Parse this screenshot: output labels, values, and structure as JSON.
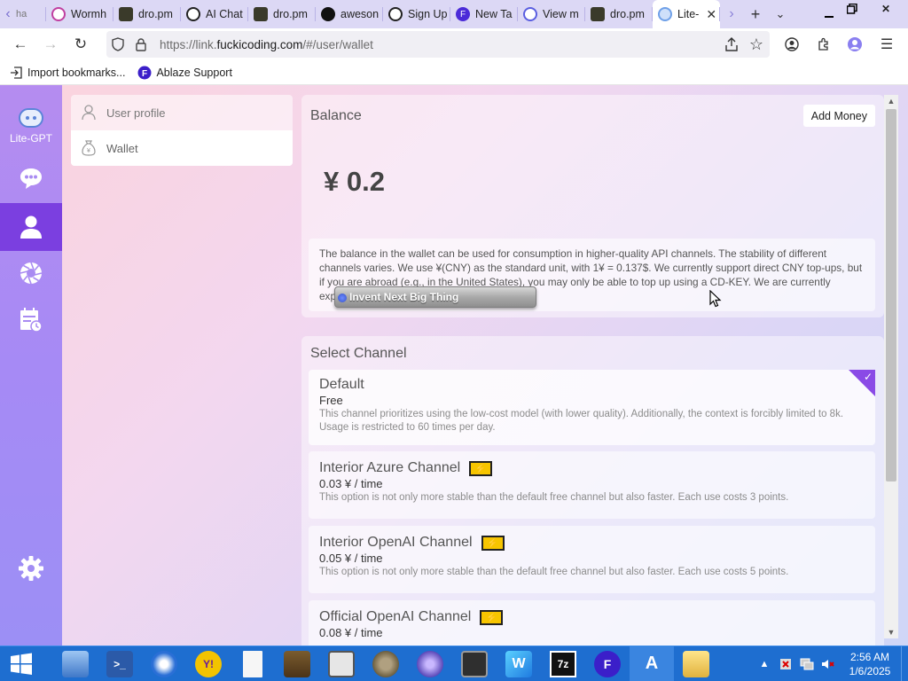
{
  "browser": {
    "tabs": [
      {
        "label": "Wormh",
        "icon": "wormhole-icon",
        "color": "#c03fa0"
      },
      {
        "label": "dro.pm",
        "icon": "dropm-icon",
        "color": "#3a3a2a"
      },
      {
        "label": "AI Chat",
        "icon": "ai-chat-icon",
        "color": "#222222"
      },
      {
        "label": "dro.pm",
        "icon": "dropm-icon",
        "color": "#3a3a2a"
      },
      {
        "label": "aweson",
        "icon": "github-icon",
        "color": "#111111"
      },
      {
        "label": "Sign Up",
        "icon": "openai-icon",
        "color": "#222222"
      },
      {
        "label": "New Ta",
        "icon": "ablaze-icon",
        "color": "#4b2bd8"
      },
      {
        "label": "View m",
        "icon": "view-icon",
        "color": "#5a5ee0"
      },
      {
        "label": "dro.pm",
        "icon": "dropm-icon",
        "color": "#3a3a2a"
      },
      {
        "label": "Lite-",
        "icon": "lite-gpt-icon",
        "color": "#6fa0e8"
      }
    ],
    "url": {
      "prefix": "https://link.",
      "domain": "fuckicoding.com",
      "path": "/#/user/wallet"
    },
    "bookmarks": [
      {
        "label": "Import bookmarks...",
        "icon": "import-icon"
      },
      {
        "label": "Ablaze Support",
        "icon": "ablaze-icon"
      }
    ]
  },
  "sidebar": {
    "app_label": "Lite-GPT",
    "items": [
      {
        "name": "chat",
        "icon": "chat-icon"
      },
      {
        "name": "user",
        "icon": "user-icon",
        "active": true
      },
      {
        "name": "aperture",
        "icon": "aperture-icon"
      },
      {
        "name": "history",
        "icon": "history-icon"
      },
      {
        "name": "settings",
        "icon": "gear-icon"
      }
    ]
  },
  "menu": {
    "items": [
      {
        "label": "User profile",
        "icon": "user-outline-icon"
      },
      {
        "label": "Wallet",
        "icon": "money-bag-icon",
        "active": true
      }
    ]
  },
  "balance": {
    "title": "Balance",
    "add_money_label": "Add Money",
    "amount": "¥ 0.2",
    "description": "The balance in the wallet can be used for consumption in higher-quality API channels. The stability of different channels varies. We use ¥(CNY) as the standard unit, with 1¥ = 0.137$. We currently support direct CNY top-ups, but if you are abroad (e.g., in the United States), you may only be able to top up using a CD-KEY. We are currently exploring payments abroad."
  },
  "tooltip": {
    "text": "Invent Next Big Thing"
  },
  "channels": {
    "title": "Select Channel",
    "items": [
      {
        "name": "Default",
        "price": "Free",
        "description": "This channel prioritizes using the low-cost model (with lower quality). Additionally, the context is forcibly limited to 8k. Usage is restricted to 60 times per day.",
        "selected": true
      },
      {
        "name": "Interior Azure Channel",
        "price": "0.03 ¥ / time",
        "description": "This option is not only more stable than the default free channel but also faster. Each use costs 3 points."
      },
      {
        "name": "Interior OpenAI Channel",
        "price": "0.05 ¥ / time",
        "description": "This option is not only more stable than the default free channel but also faster. Each use costs 5 points."
      },
      {
        "name": "Official OpenAI Channel",
        "price": "0.08 ¥ / time",
        "description": ""
      }
    ]
  },
  "taskbar": {
    "apps": [
      {
        "name": "file-manager",
        "label": ""
      },
      {
        "name": "powershell",
        "label": ">_"
      },
      {
        "name": "thunderbird",
        "label": ""
      },
      {
        "name": "yahoo-messenger",
        "label": "Y!"
      },
      {
        "name": "blank-document",
        "label": ""
      },
      {
        "name": "minecraft",
        "label": ""
      },
      {
        "name": "disk-tool",
        "label": ""
      },
      {
        "name": "gimp",
        "label": ""
      },
      {
        "name": "settings-gear",
        "label": ""
      },
      {
        "name": "terminal-monitor",
        "label": ""
      },
      {
        "name": "wavebox",
        "label": "W"
      },
      {
        "name": "7zip",
        "label": "7z"
      },
      {
        "name": "ablaze",
        "label": ""
      },
      {
        "name": "arduino",
        "label": "A"
      },
      {
        "name": "folder",
        "label": ""
      }
    ],
    "time": "2:56 AM",
    "date": "1/6/2025"
  },
  "colors": {
    "sidebar_active": "#7b3fe0",
    "accent": "#8a4ae6",
    "taskbar": "#1e6ed0",
    "bolt": "#f7c500"
  }
}
